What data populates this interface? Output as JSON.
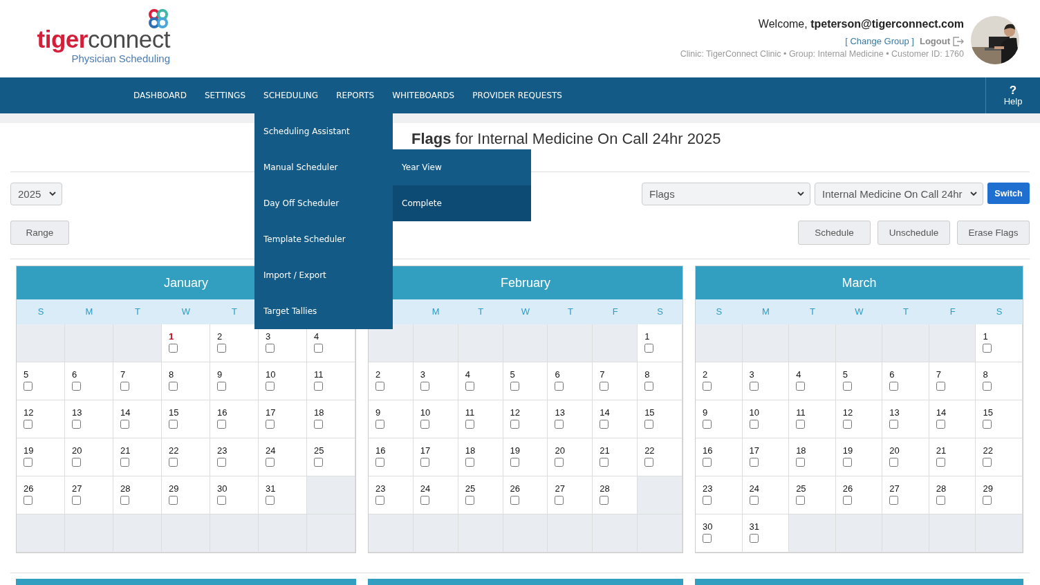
{
  "logo": {
    "brand_primary": "tiger",
    "brand_secondary": "connect",
    "tagline": "Physician Scheduling"
  },
  "user": {
    "welcome": "Welcome, **tpeterson@tigerconnect.com**",
    "change_group": "[ Change Group ]",
    "logout": "Logout",
    "info": "Clinic: TigerConnect Clinic • Group: Internal Medicine • Customer ID: 1760"
  },
  "nav": [
    {
      "label": "DASHBOARD"
    },
    {
      "label": "SETTINGS"
    },
    {
      "label": "SCHEDULING",
      "menu": [
        {
          "label": "Scheduling Assistant"
        },
        {
          "label": "Manual Scheduler",
          "children": [
            {
              "label": "Year View",
              "selected": false
            },
            {
              "label": "Complete",
              "selected": true
            }
          ]
        },
        {
          "label": "Day Off Scheduler"
        },
        {
          "label": "Template Scheduler"
        },
        {
          "label": "Import / Export"
        },
        {
          "label": "Target Tallies"
        }
      ]
    },
    {
      "label": "REPORTS"
    },
    {
      "label": "WHITEBOARDS"
    },
    {
      "label": "PROVIDER REQUESTS"
    }
  ],
  "help": {
    "icon": "?",
    "label": "Help"
  },
  "page_title": "**Flags** for Internal Medicine On Call 24hr 2025",
  "year_select": "2025",
  "range_button": "Range",
  "type_select": "Flags",
  "calendar_select": "Internal Medicine On Call 24hr",
  "switch_button": "Switch",
  "action_buttons": [
    "Schedule",
    "Unschedule",
    "Erase Flags"
  ],
  "months": [
    {
      "name": "January",
      "weekdays": [
        {
          "kind": "label",
          "text": "S"
        },
        {
          "kind": "label",
          "text": "M"
        },
        {
          "kind": "label",
          "text": "T"
        },
        {
          "kind": "label",
          "text": "W"
        },
        {
          "kind": "label",
          "text": "T"
        },
        {
          "kind": "covered"
        },
        {
          "kind": "covered"
        }
      ],
      "weeks": [
        [
          {
            "kind": "blank"
          },
          {
            "kind": "blank"
          },
          {
            "kind": "blank"
          },
          {
            "kind": "day",
            "day": "1",
            "checked": false,
            "today": true
          },
          {
            "kind": "day",
            "day": "2",
            "checked": false,
            "today": false
          },
          {
            "kind": "day",
            "day": "3",
            "checked": false,
            "today": false
          },
          {
            "kind": "day",
            "day": "4",
            "checked": false,
            "today": false
          }
        ],
        [
          {
            "kind": "day",
            "day": "5",
            "checked": false,
            "today": false
          },
          {
            "kind": "day",
            "day": "6",
            "checked": false,
            "today": false
          },
          {
            "kind": "day",
            "day": "7",
            "checked": false,
            "today": false
          },
          {
            "kind": "day",
            "day": "8",
            "checked": false,
            "today": false
          },
          {
            "kind": "day",
            "day": "9",
            "checked": false,
            "today": false
          },
          {
            "kind": "day",
            "day": "10",
            "checked": false,
            "today": false
          },
          {
            "kind": "day",
            "day": "11",
            "checked": false,
            "today": false
          }
        ],
        [
          {
            "kind": "day",
            "day": "12",
            "checked": false,
            "today": false
          },
          {
            "kind": "day",
            "day": "13",
            "checked": false,
            "today": false
          },
          {
            "kind": "day",
            "day": "14",
            "checked": false,
            "today": false
          },
          {
            "kind": "day",
            "day": "15",
            "checked": false,
            "today": false
          },
          {
            "kind": "day",
            "day": "16",
            "checked": false,
            "today": false
          },
          {
            "kind": "day",
            "day": "17",
            "checked": false,
            "today": false
          },
          {
            "kind": "day",
            "day": "18",
            "checked": false,
            "today": false
          }
        ],
        [
          {
            "kind": "day",
            "day": "19",
            "checked": false,
            "today": false
          },
          {
            "kind": "day",
            "day": "20",
            "checked": false,
            "today": false
          },
          {
            "kind": "day",
            "day": "21",
            "checked": false,
            "today": false
          },
          {
            "kind": "day",
            "day": "22",
            "checked": false,
            "today": false
          },
          {
            "kind": "day",
            "day": "23",
            "checked": false,
            "today": false
          },
          {
            "kind": "day",
            "day": "24",
            "checked": false,
            "today": false
          },
          {
            "kind": "day",
            "day": "25",
            "checked": false,
            "today": false
          }
        ],
        [
          {
            "kind": "day",
            "day": "26",
            "checked": false,
            "today": false
          },
          {
            "kind": "day",
            "day": "27",
            "checked": false,
            "today": false
          },
          {
            "kind": "day",
            "day": "28",
            "checked": false,
            "today": false
          },
          {
            "kind": "day",
            "day": "29",
            "checked": false,
            "today": false
          },
          {
            "kind": "day",
            "day": "30",
            "checked": false,
            "today": false
          },
          {
            "kind": "day",
            "day": "31",
            "checked": false,
            "today": false
          },
          {
            "kind": "blank"
          }
        ],
        [
          {
            "kind": "blank"
          },
          {
            "kind": "blank"
          },
          {
            "kind": "blank"
          },
          {
            "kind": "blank"
          },
          {
            "kind": "blank"
          },
          {
            "kind": "blank"
          },
          {
            "kind": "blank"
          }
        ]
      ]
    },
    {
      "name": "February",
      "weekdays": [
        {
          "kind": "covered"
        },
        {
          "kind": "label",
          "text": "M"
        },
        {
          "kind": "label",
          "text": "T"
        },
        {
          "kind": "label",
          "text": "W"
        },
        {
          "kind": "label",
          "text": "T"
        },
        {
          "kind": "label",
          "text": "F"
        },
        {
          "kind": "label",
          "text": "S"
        }
      ],
      "weeks": [
        [
          {
            "kind": "blank"
          },
          {
            "kind": "blank"
          },
          {
            "kind": "blank"
          },
          {
            "kind": "blank"
          },
          {
            "kind": "blank"
          },
          {
            "kind": "blank"
          },
          {
            "kind": "day",
            "day": "1",
            "checked": false,
            "today": false
          }
        ],
        [
          {
            "kind": "day",
            "day": "2",
            "checked": false,
            "today": false
          },
          {
            "kind": "day",
            "day": "3",
            "checked": false,
            "today": false
          },
          {
            "kind": "day",
            "day": "4",
            "checked": false,
            "today": false
          },
          {
            "kind": "day",
            "day": "5",
            "checked": false,
            "today": false
          },
          {
            "kind": "day",
            "day": "6",
            "checked": false,
            "today": false
          },
          {
            "kind": "day",
            "day": "7",
            "checked": false,
            "today": false
          },
          {
            "kind": "day",
            "day": "8",
            "checked": false,
            "today": false
          }
        ],
        [
          {
            "kind": "day",
            "day": "9",
            "checked": false,
            "today": false
          },
          {
            "kind": "day",
            "day": "10",
            "checked": false,
            "today": false
          },
          {
            "kind": "day",
            "day": "11",
            "checked": false,
            "today": false
          },
          {
            "kind": "day",
            "day": "12",
            "checked": false,
            "today": false
          },
          {
            "kind": "day",
            "day": "13",
            "checked": false,
            "today": false
          },
          {
            "kind": "day",
            "day": "14",
            "checked": false,
            "today": false
          },
          {
            "kind": "day",
            "day": "15",
            "checked": false,
            "today": false
          }
        ],
        [
          {
            "kind": "day",
            "day": "16",
            "checked": false,
            "today": false
          },
          {
            "kind": "day",
            "day": "17",
            "checked": false,
            "today": false
          },
          {
            "kind": "day",
            "day": "18",
            "checked": false,
            "today": false
          },
          {
            "kind": "day",
            "day": "19",
            "checked": false,
            "today": false
          },
          {
            "kind": "day",
            "day": "20",
            "checked": false,
            "today": false
          },
          {
            "kind": "day",
            "day": "21",
            "checked": false,
            "today": false
          },
          {
            "kind": "day",
            "day": "22",
            "checked": false,
            "today": false
          }
        ],
        [
          {
            "kind": "day",
            "day": "23",
            "checked": false,
            "today": false
          },
          {
            "kind": "day",
            "day": "24",
            "checked": false,
            "today": false
          },
          {
            "kind": "day",
            "day": "25",
            "checked": false,
            "today": false
          },
          {
            "kind": "day",
            "day": "26",
            "checked": false,
            "today": false
          },
          {
            "kind": "day",
            "day": "27",
            "checked": false,
            "today": false
          },
          {
            "kind": "day",
            "day": "28",
            "checked": false,
            "today": false
          },
          {
            "kind": "blank"
          }
        ],
        [
          {
            "kind": "blank"
          },
          {
            "kind": "blank"
          },
          {
            "kind": "blank"
          },
          {
            "kind": "blank"
          },
          {
            "kind": "blank"
          },
          {
            "kind": "blank"
          },
          {
            "kind": "blank"
          }
        ]
      ]
    },
    {
      "name": "March",
      "weekdays": [
        {
          "kind": "label",
          "text": "S"
        },
        {
          "kind": "label",
          "text": "M"
        },
        {
          "kind": "label",
          "text": "T"
        },
        {
          "kind": "label",
          "text": "W"
        },
        {
          "kind": "label",
          "text": "T"
        },
        {
          "kind": "label",
          "text": "F"
        },
        {
          "kind": "label",
          "text": "S"
        }
      ],
      "weeks": [
        [
          {
            "kind": "blank"
          },
          {
            "kind": "blank"
          },
          {
            "kind": "blank"
          },
          {
            "kind": "blank"
          },
          {
            "kind": "blank"
          },
          {
            "kind": "blank"
          },
          {
            "kind": "day",
            "day": "1",
            "checked": false,
            "today": false
          }
        ],
        [
          {
            "kind": "day",
            "day": "2",
            "checked": false,
            "today": false
          },
          {
            "kind": "day",
            "day": "3",
            "checked": false,
            "today": false
          },
          {
            "kind": "day",
            "day": "4",
            "checked": false,
            "today": false
          },
          {
            "kind": "day",
            "day": "5",
            "checked": false,
            "today": false
          },
          {
            "kind": "day",
            "day": "6",
            "checked": false,
            "today": false
          },
          {
            "kind": "day",
            "day": "7",
            "checked": false,
            "today": false
          },
          {
            "kind": "day",
            "day": "8",
            "checked": false,
            "today": false
          }
        ],
        [
          {
            "kind": "day",
            "day": "9",
            "checked": false,
            "today": false
          },
          {
            "kind": "day",
            "day": "10",
            "checked": false,
            "today": false
          },
          {
            "kind": "day",
            "day": "11",
            "checked": false,
            "today": false
          },
          {
            "kind": "day",
            "day": "12",
            "checked": false,
            "today": false
          },
          {
            "kind": "day",
            "day": "13",
            "checked": false,
            "today": false
          },
          {
            "kind": "day",
            "day": "14",
            "checked": false,
            "today": false
          },
          {
            "kind": "day",
            "day": "15",
            "checked": false,
            "today": false
          }
        ],
        [
          {
            "kind": "day",
            "day": "16",
            "checked": false,
            "today": false
          },
          {
            "kind": "day",
            "day": "17",
            "checked": false,
            "today": false
          },
          {
            "kind": "day",
            "day": "18",
            "checked": false,
            "today": false
          },
          {
            "kind": "day",
            "day": "19",
            "checked": false,
            "today": false
          },
          {
            "kind": "day",
            "day": "20",
            "checked": false,
            "today": false
          },
          {
            "kind": "day",
            "day": "21",
            "checked": false,
            "today": false
          },
          {
            "kind": "day",
            "day": "22",
            "checked": false,
            "today": false
          }
        ],
        [
          {
            "kind": "day",
            "day": "23",
            "checked": false,
            "today": false
          },
          {
            "kind": "day",
            "day": "24",
            "checked": false,
            "today": false
          },
          {
            "kind": "day",
            "day": "25",
            "checked": false,
            "today": false
          },
          {
            "kind": "day",
            "day": "26",
            "checked": false,
            "today": false
          },
          {
            "kind": "day",
            "day": "27",
            "checked": false,
            "today": false
          },
          {
            "kind": "day",
            "day": "28",
            "checked": false,
            "today": false
          },
          {
            "kind": "day",
            "day": "29",
            "checked": false,
            "today": false
          }
        ],
        [
          {
            "kind": "day",
            "day": "30",
            "checked": false,
            "today": false
          },
          {
            "kind": "day",
            "day": "31",
            "checked": false,
            "today": false
          },
          {
            "kind": "blank"
          },
          {
            "kind": "blank"
          },
          {
            "kind": "blank"
          },
          {
            "kind": "blank"
          },
          {
            "kind": "blank"
          }
        ]
      ]
    }
  ]
}
